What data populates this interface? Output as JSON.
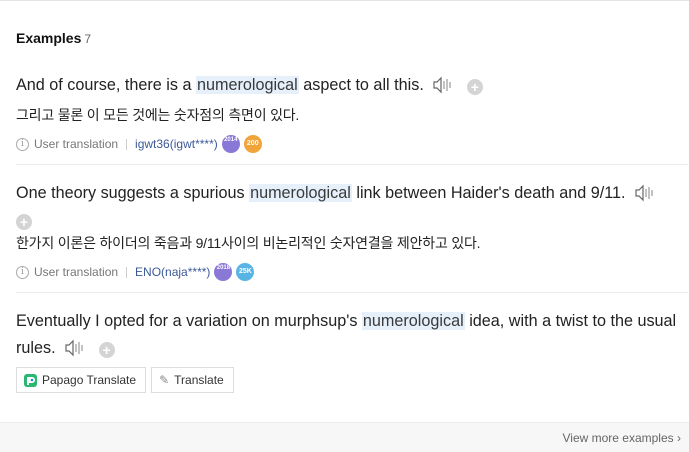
{
  "header": {
    "title": "Examples",
    "count": "7"
  },
  "examples": [
    {
      "before": "And of course, there is a ",
      "highlight": "numerological",
      "after": " aspect to all this.",
      "translation": "그리고 물론 이 모든 것에는 숫자점의 측면이 있다.",
      "source": "User translation",
      "user": "igwt36(igwt****)",
      "badges": [
        "2014",
        "200"
      ]
    },
    {
      "before": "One theory suggests a spurious ",
      "highlight": "numerological",
      "after": " link between Haider's death and 9/11.",
      "translation": "한가지 이론은 하이더의 죽음과 9/11사이의 비논리적인 숫자연결을 제안하고 있다.",
      "source": "User translation",
      "user": "ENO(naja****)",
      "badges": [
        "2018",
        "25K"
      ]
    },
    {
      "before": "Eventually I opted for a variation on murphsup's ",
      "highlight": "numerological",
      "after": " idea, with a twist to the usual rules."
    }
  ],
  "buttons": {
    "papago": "Papago Translate",
    "translate": "Translate"
  },
  "footer": {
    "more": "View more examples"
  },
  "colors": {
    "highlight": "#e6f0fb",
    "user_link": "#3b5998",
    "badge_purple": "#8a78d6",
    "badge_orange": "#f0a43a",
    "badge_blue": "#58b4e4"
  },
  "icons": [
    "speaker-icon",
    "add-icon",
    "info-icon",
    "papago-icon",
    "pencil-icon",
    "chevron-right-icon"
  ]
}
